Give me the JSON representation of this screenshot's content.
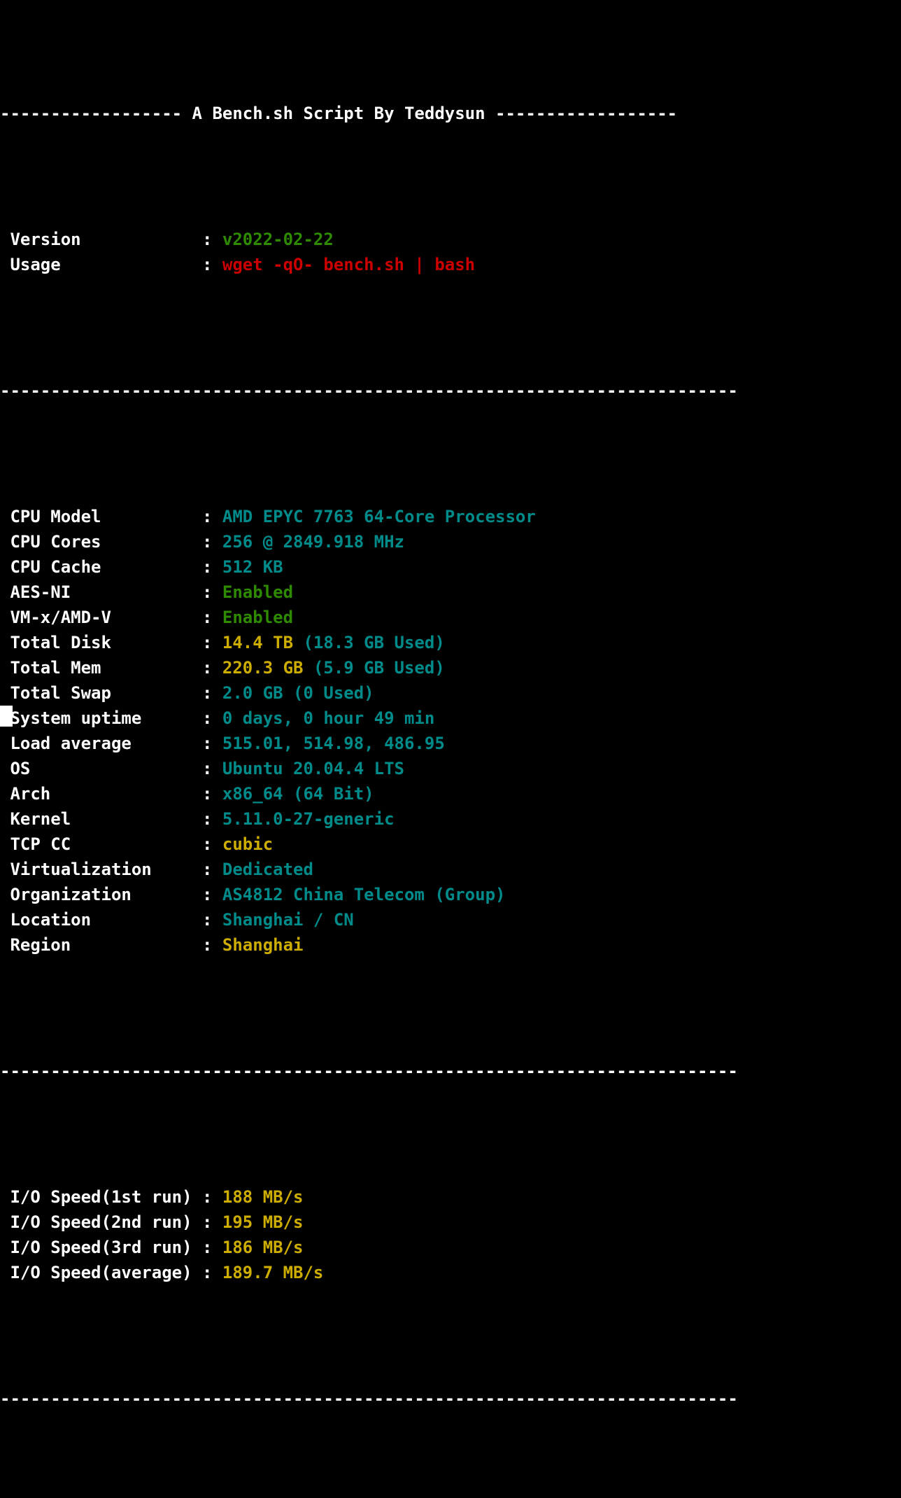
{
  "terminal": {
    "title_bar": {
      "left_rule": "------------------",
      "title": " A Bench.sh Script By Teddysun ",
      "right_rule": "------------------"
    },
    "divider": "-------------------------------------------------------------------------",
    "colors": {
      "background": "#000000",
      "foreground": "#ffffff",
      "green": "#2e8b00",
      "red": "#cc0000",
      "teal": "#008b8b",
      "gold": "#cdad00"
    },
    "header_rows": [
      {
        "label": "Version",
        "separator": ":",
        "segments": [
          {
            "text": "v2022-02-22",
            "color": "green"
          }
        ]
      },
      {
        "label": "Usage",
        "separator": ":",
        "segments": [
          {
            "text": "wget -qO- bench.sh | bash",
            "color": "red"
          }
        ]
      }
    ],
    "info_rows": [
      {
        "label": "CPU Model",
        "separator": ":",
        "segments": [
          {
            "text": "AMD EPYC 7763 64-Core Processor",
            "color": "teal"
          }
        ]
      },
      {
        "label": "CPU Cores",
        "separator": ":",
        "segments": [
          {
            "text": "256 @ 2849.918 MHz",
            "color": "teal"
          }
        ]
      },
      {
        "label": "CPU Cache",
        "separator": ":",
        "segments": [
          {
            "text": "512 KB",
            "color": "teal"
          }
        ]
      },
      {
        "label": "AES-NI",
        "separator": ":",
        "segments": [
          {
            "text": "Enabled",
            "color": "green"
          }
        ]
      },
      {
        "label": "VM-x/AMD-V",
        "separator": ":",
        "segments": [
          {
            "text": "Enabled",
            "color": "green"
          }
        ]
      },
      {
        "label": "Total Disk",
        "separator": ":",
        "segments": [
          {
            "text": "14.4 TB ",
            "color": "gold"
          },
          {
            "text": "(18.3 GB Used)",
            "color": "teal"
          }
        ]
      },
      {
        "label": "Total Mem",
        "separator": ":",
        "segments": [
          {
            "text": "220.3 GB ",
            "color": "gold"
          },
          {
            "text": "(5.9 GB Used)",
            "color": "teal"
          }
        ]
      },
      {
        "label": "Total Swap",
        "separator": ":",
        "segments": [
          {
            "text": "2.0 GB (0 Used)",
            "color": "teal"
          }
        ]
      },
      {
        "label": "System uptime",
        "separator": ":",
        "segments": [
          {
            "text": "0 days, 0 hour 49 min",
            "color": "teal"
          }
        ]
      },
      {
        "label": "Load average",
        "separator": ":",
        "segments": [
          {
            "text": "515.01, 514.98, 486.95",
            "color": "teal"
          }
        ]
      },
      {
        "label": "OS",
        "separator": ":",
        "segments": [
          {
            "text": "Ubuntu 20.04.4 LTS",
            "color": "teal"
          }
        ]
      },
      {
        "label": "Arch",
        "separator": ":",
        "segments": [
          {
            "text": "x86_64 (64 Bit)",
            "color": "teal"
          }
        ]
      },
      {
        "label": "Kernel",
        "separator": ":",
        "segments": [
          {
            "text": "5.11.0-27-generic",
            "color": "teal"
          }
        ]
      },
      {
        "label": "TCP CC",
        "separator": ":",
        "segments": [
          {
            "text": "cubic",
            "color": "gold"
          }
        ]
      },
      {
        "label": "Virtualization",
        "separator": ":",
        "segments": [
          {
            "text": "Dedicated",
            "color": "teal"
          }
        ]
      },
      {
        "label": "Organization",
        "separator": ":",
        "segments": [
          {
            "text": "AS4812 China Telecom (Group)",
            "color": "teal"
          }
        ]
      },
      {
        "label": "Location",
        "separator": ":",
        "segments": [
          {
            "text": "Shanghai / CN",
            "color": "teal"
          }
        ]
      },
      {
        "label": "Region",
        "separator": ":",
        "segments": [
          {
            "text": "Shanghai",
            "color": "gold"
          }
        ]
      }
    ],
    "io_rows": [
      {
        "label": "I/O Speed(1st run)",
        "separator": ":",
        "segments": [
          {
            "text": "188 MB/s",
            "color": "gold"
          }
        ]
      },
      {
        "label": "I/O Speed(2nd run)",
        "separator": ":",
        "segments": [
          {
            "text": "195 MB/s",
            "color": "gold"
          }
        ]
      },
      {
        "label": "I/O Speed(3rd run)",
        "separator": ":",
        "segments": [
          {
            "text": "186 MB/s",
            "color": "gold"
          }
        ]
      },
      {
        "label": "I/O Speed(average)",
        "separator": ":",
        "segments": [
          {
            "text": "189.7 MB/s",
            "color": "gold"
          }
        ]
      }
    ],
    "cursor": {
      "visible": true,
      "glyph": " "
    }
  }
}
